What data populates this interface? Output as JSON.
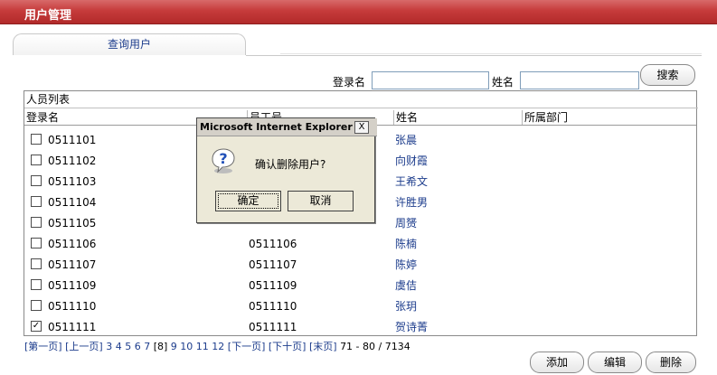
{
  "header": {
    "title": "用户管理"
  },
  "tabs": [
    {
      "label": "查询用户"
    }
  ],
  "search": {
    "login_label": "登录名",
    "login_value": "",
    "name_label": "姓名",
    "name_value": "",
    "search_button": "搜索"
  },
  "list": {
    "title": "人员列表",
    "columns": [
      "登录名",
      "员工号",
      "姓名",
      "所属部门"
    ],
    "rows": [
      {
        "login": "0511101",
        "emp": "",
        "name": "张晨",
        "dept": "",
        "checked": false
      },
      {
        "login": "0511102",
        "emp": "",
        "name": "向财霞",
        "dept": "",
        "checked": false
      },
      {
        "login": "0511103",
        "emp": "",
        "name": "王希文",
        "dept": "",
        "checked": false
      },
      {
        "login": "0511104",
        "emp": "",
        "name": "许胜男",
        "dept": "",
        "checked": false
      },
      {
        "login": "0511105",
        "emp": "",
        "name": "周赟",
        "dept": "",
        "checked": false
      },
      {
        "login": "0511106",
        "emp": "0511106",
        "name": "陈楠",
        "dept": "",
        "checked": false
      },
      {
        "login": "0511107",
        "emp": "0511107",
        "name": "陈婷",
        "dept": "",
        "checked": false
      },
      {
        "login": "0511109",
        "emp": "0511109",
        "name": "虞佶",
        "dept": "",
        "checked": false
      },
      {
        "login": "0511110",
        "emp": "0511110",
        "name": "张玥",
        "dept": "",
        "checked": false
      },
      {
        "login": "0511111",
        "emp": "0511111",
        "name": "贺诗菁",
        "dept": "",
        "checked": true
      }
    ]
  },
  "pager": {
    "first": "[第一页]",
    "prev": "[上一页]",
    "pages": [
      "3",
      "4",
      "5",
      "6",
      "7"
    ],
    "current": "[8]",
    "pages_after": [
      "9",
      "10",
      "11",
      "12"
    ],
    "next": "[下一页]",
    "next10": "[下十页]",
    "last": "[末页]",
    "info": "71 - 80 / 7134"
  },
  "actions": {
    "add": "添加",
    "edit": "编辑",
    "delete": "删除"
  },
  "dialog": {
    "title": "Microsoft Internet Explorer",
    "close": "X",
    "message": "确认删除用户?",
    "ok": "确定",
    "cancel": "取消",
    "icon": "question-icon"
  },
  "colors": {
    "header_red": "#c63b3b",
    "link_blue": "#1c3c8c",
    "dialog_bg": "#ece9d8"
  }
}
